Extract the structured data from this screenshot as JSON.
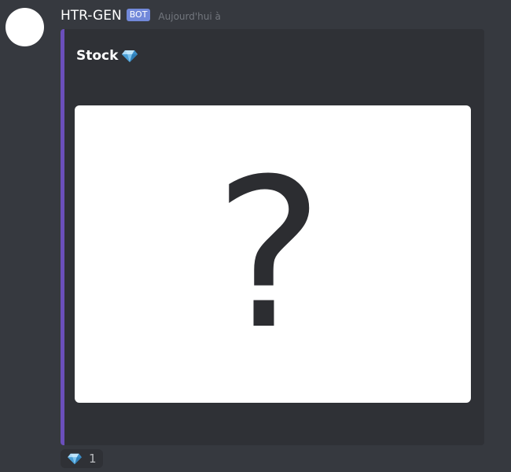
{
  "message": {
    "author": {
      "name": "HTR-GEN",
      "bot_tag": "BOT"
    },
    "timestamp": "Aujourd'hui à"
  },
  "embed": {
    "title": "Stock",
    "title_icon": "gem-icon",
    "accent_color": "#6b4fbb",
    "image": {
      "icon": "question-mark-icon"
    }
  },
  "reactions": [
    {
      "emoji": "gem-icon",
      "count": "1"
    }
  ],
  "colors": {
    "background": "#36393f",
    "embed_background": "#2f3136",
    "bot_tag": "#7289da",
    "timestamp": "#72767d"
  }
}
